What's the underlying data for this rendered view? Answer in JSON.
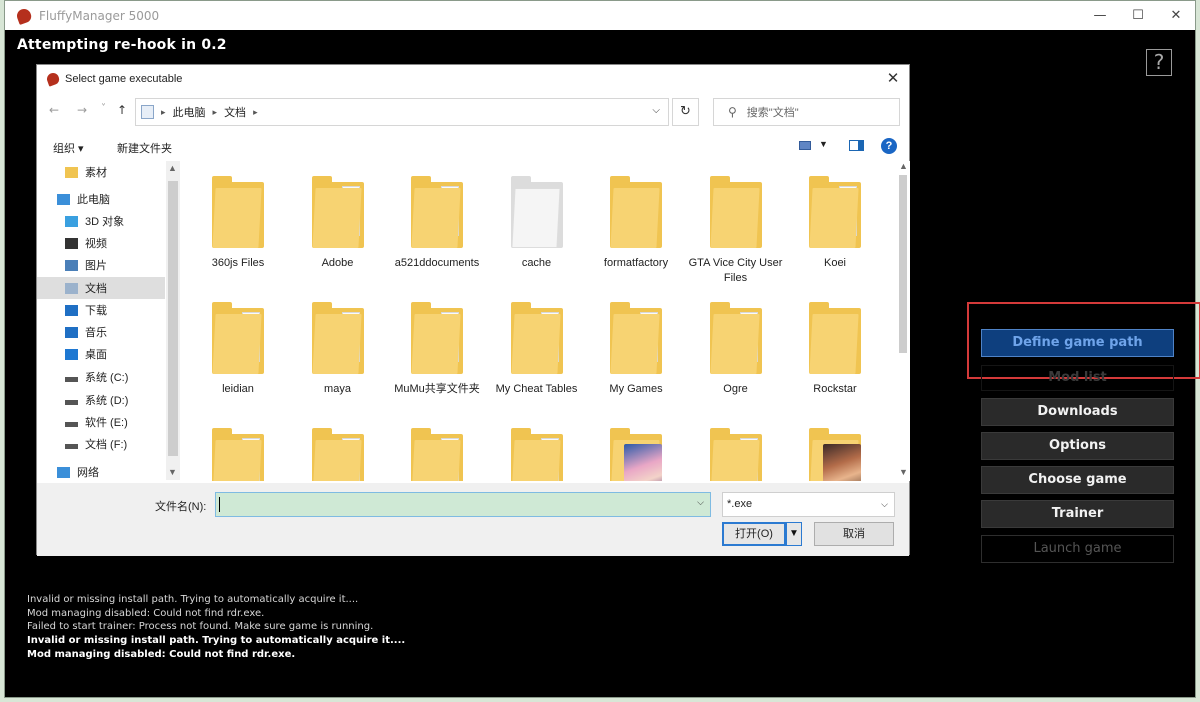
{
  "window": {
    "title": "FluffyManager 5000",
    "minimize": "—",
    "maximize": "☐",
    "close": "✕"
  },
  "status": "Attempting re-hook in 0.2",
  "help_label": "?",
  "side_buttons": {
    "define": "Define game path",
    "modlist": "Mod list",
    "downloads": "Downloads",
    "options": "Options",
    "choose": "Choose game",
    "trainer": "Trainer",
    "launch": "Launch game"
  },
  "log": [
    "Invalid or missing install path. Trying to automatically acquire it....",
    "Mod managing disabled: Could not find rdr.exe.",
    "Failed to start trainer: Process not found. Make sure game is running.",
    "Invalid or missing install path. Trying to automatically acquire it....",
    "Mod managing disabled: Could not find rdr.exe."
  ],
  "dialog": {
    "title": "Select game executable",
    "close": "✕",
    "nav": {
      "back": "←",
      "forward": "→",
      "recent": "˅",
      "up": "↑"
    },
    "address": [
      "此电脑",
      "文档"
    ],
    "refresh": "↻",
    "search_placeholder": "搜索\"文档\"",
    "toolbar": {
      "organize": "组织 ▾",
      "new_folder": "新建文件夹",
      "help": "?"
    },
    "nav_pane": [
      {
        "label": "素材",
        "icon": "folder-icon"
      },
      {
        "label": "此电脑",
        "icon": "computer-icon"
      },
      {
        "label": "3D 对象",
        "icon": "cube-icon"
      },
      {
        "label": "视频",
        "icon": "video-icon"
      },
      {
        "label": "图片",
        "icon": "picture-icon"
      },
      {
        "label": "文档",
        "icon": "document-icon"
      },
      {
        "label": "下载",
        "icon": "download-icon"
      },
      {
        "label": "音乐",
        "icon": "music-icon"
      },
      {
        "label": "桌面",
        "icon": "desktop-icon"
      },
      {
        "label": "系统 (C:)",
        "icon": "drive-icon"
      },
      {
        "label": "系统 (D:)",
        "icon": "drive-icon"
      },
      {
        "label": "软件 (E:)",
        "icon": "drive-icon"
      },
      {
        "label": "文档 (F:)",
        "icon": "drive-icon"
      },
      {
        "label": "网络",
        "icon": "network-icon"
      }
    ],
    "files": [
      {
        "name": "360js Files",
        "kind": "plain"
      },
      {
        "name": "Adobe",
        "kind": "doc"
      },
      {
        "name": "a521ddocuments",
        "kind": "doc"
      },
      {
        "name": "cache",
        "kind": "white"
      },
      {
        "name": "formatfactory",
        "kind": "plain"
      },
      {
        "name": "GTA Vice City User Files",
        "kind": "plain"
      },
      {
        "name": "Koei",
        "kind": "doc"
      },
      {
        "name": "leidian",
        "kind": "doc"
      },
      {
        "name": "maya",
        "kind": "doc"
      },
      {
        "name": "MuMu共享文件夹",
        "kind": "doc"
      },
      {
        "name": "My Cheat Tables",
        "kind": "doc"
      },
      {
        "name": "My Games",
        "kind": "doc"
      },
      {
        "name": "Ogre",
        "kind": "doc"
      },
      {
        "name": "Rockstar",
        "kind": "plain"
      },
      {
        "name": "",
        "kind": "doc"
      },
      {
        "name": "",
        "kind": "doc"
      },
      {
        "name": "",
        "kind": "doc"
      },
      {
        "name": "",
        "kind": "doc"
      },
      {
        "name": "",
        "kind": "anime"
      },
      {
        "name": "",
        "kind": "doc"
      },
      {
        "name": "",
        "kind": "anime2"
      }
    ],
    "filename_label": "文件名(N):",
    "filename_value": "",
    "filetype": "*.exe",
    "open": "打开(O)",
    "cancel": "取消"
  },
  "colors": {
    "define_bg": "#0e3f7e",
    "highlight": "#d43a3a",
    "folder": "#f0c451"
  }
}
